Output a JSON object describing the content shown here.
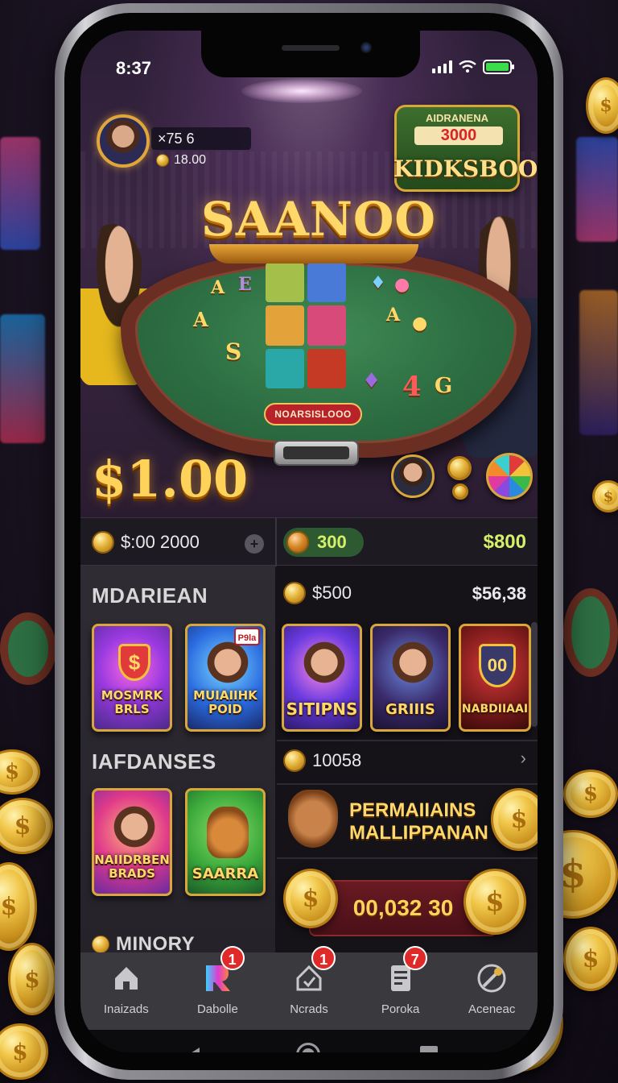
{
  "status_bar": {
    "time": "8:37",
    "battery_level": 1.0
  },
  "header": {
    "player_name": "×75 6",
    "player_coins": "18.00",
    "event_small": "AIDRANENA",
    "event_amount": "3000",
    "event_title": "KIDKSBOO"
  },
  "scene": {
    "game_title": "SAANOO",
    "table_banner": "NOARSISLOOO",
    "big_amount": "$1.00"
  },
  "wallet_bar": {
    "left_amount": "$:00 2000",
    "pill_amount": "300",
    "right_amount": "$800"
  },
  "left_panel": {
    "section1_title": "MDARIEAN",
    "cards1": [
      {
        "label": "MOSMRK BRLS"
      },
      {
        "label": "MUIAIIHK POID",
        "badge": "P9la"
      }
    ],
    "section2_title": "IAFDANSES",
    "cards2": [
      {
        "label": "NAIIDRBEN BRADS"
      },
      {
        "label": "SAARRA"
      }
    ],
    "section3_title": "MINORY"
  },
  "right_panel": {
    "row1_left": "$500",
    "row1_right": "$56,38",
    "cards": [
      {
        "label": "SITIPNS"
      },
      {
        "label": "GRIIIS"
      },
      {
        "label": "NABDIIAAI"
      }
    ],
    "row2_text": "10058",
    "promo_line1": "PERMAIIAINS",
    "promo_line2": "MALLIPPANAN",
    "jackpot": "00,032 30"
  },
  "tabs": [
    {
      "label": "Inaizads",
      "badge": ""
    },
    {
      "label": "Dabolle",
      "badge": "1"
    },
    {
      "label": "Ncrads",
      "badge": "1"
    },
    {
      "label": "Poroka",
      "badge": "7"
    },
    {
      "label": "Aceneac",
      "badge": ""
    }
  ],
  "colors": {
    "accent_gold": "#ffd25a",
    "felt_green": "#2d6e42",
    "badge_red": "#e02a2a",
    "lime": "#d6f06a"
  }
}
